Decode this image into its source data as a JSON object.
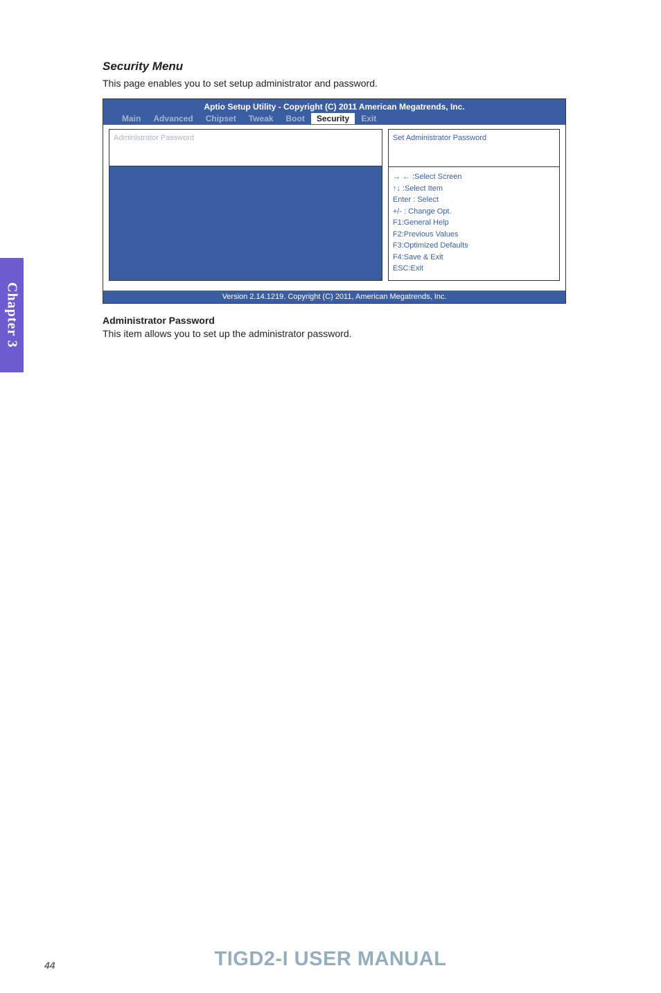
{
  "section": {
    "title": "Security Menu",
    "desc": "This page enables you to set setup administrator and password."
  },
  "bios": {
    "header_title": "Aptio Setup Utility - Copyright (C) 2011 American Megatrends, Inc.",
    "tabs": {
      "main": "Main",
      "advanced": "Advanced",
      "chipset": "Chipset",
      "tweak": "Tweak",
      "boot": "Boot",
      "security": "Security",
      "exit": "Exit"
    },
    "left_panel_item": "Administrator Password",
    "right_panel_top": "Set Administrator Password",
    "help": {
      "l1": "→ ← :Select Screen",
      "l2": "↑↓ :Select Item",
      "l3": "Enter : Select",
      "l4": "+/-  : Change Opt.",
      "l5": "F1:General Help",
      "l6": "F2:Previous Values",
      "l7": "F3:Optimized Defaults",
      "l8": "F4:Save & Exit",
      "l9": "ESC:Exit"
    },
    "footer": "Version  2.14.1219.  Copyright (C) 2011, American Megatrends, Inc."
  },
  "sub": {
    "heading": "Administrator Password",
    "desc": "This item allows you to set up the administrator password."
  },
  "chapter_tab": "Chapter 3",
  "page_num": "44",
  "manual_title": "TIGD2-I USER MANUAL"
}
